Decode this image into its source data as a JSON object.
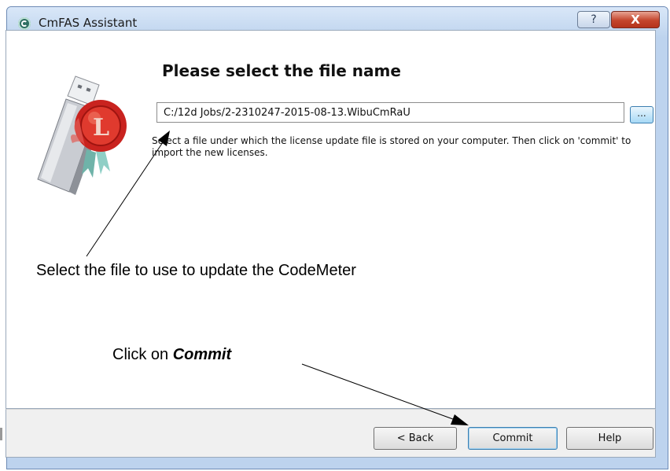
{
  "window": {
    "title": "CmFAS Assistant",
    "help_glyph": "?",
    "close_glyph": "X"
  },
  "page": {
    "heading": "Please select the file name",
    "file_path": "C:/12d Jobs/2-2310247-2015-08-13.WibuCmRaU",
    "browse_label": "...",
    "description": "Select a file under which the license update file is stored on your computer. Then click on 'commit' to import the new licenses."
  },
  "annotations": {
    "select_note": "Select the file to use to update the CodeMeter",
    "click_prefix": "Click on ",
    "click_target": "Commit"
  },
  "buttons": {
    "back": "< Back",
    "commit": "Commit",
    "help": "Help"
  },
  "icons": {
    "app": "codemeter-logo-icon",
    "illustration": "usb-license-dongle-icon"
  }
}
